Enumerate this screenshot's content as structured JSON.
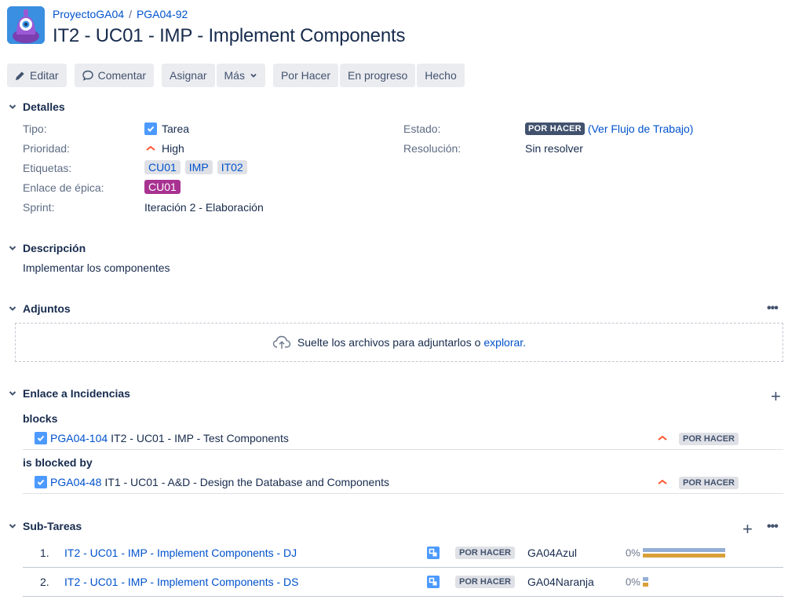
{
  "breadcrumbs": {
    "project": "ProyectoGA04",
    "separator": "/",
    "issue_key": "PGA04-92"
  },
  "title": "IT2 - UC01 - IMP - Implement Components",
  "toolbar": {
    "edit": "Editar",
    "comment": "Comentar",
    "assign": "Asignar",
    "more": "Más",
    "todo": "Por Hacer",
    "in_progress": "En progreso",
    "done": "Hecho"
  },
  "details": {
    "heading": "Detalles",
    "type_label": "Tipo:",
    "type_value": "Tarea",
    "priority_label": "Prioridad:",
    "priority_value": "High",
    "labels_label": "Etiquetas:",
    "labels": [
      "CU01",
      "IMP",
      "IT02"
    ],
    "epic_label": "Enlace de épica:",
    "epic_value": "CU01",
    "sprint_label": "Sprint:",
    "sprint_value": "Iteración 2 - Elaboración",
    "status_label": "Estado:",
    "status_value": "POR HACER",
    "workflow_link": "(Ver Flujo de Trabajo)",
    "resolution_label": "Resolución:",
    "resolution_value": "Sin resolver"
  },
  "description": {
    "heading": "Descripción",
    "text": "Implementar los componentes"
  },
  "attachments": {
    "heading": "Adjuntos",
    "more": "•••",
    "drop_text": "Suelte los archivos para adjuntarlos o",
    "browse": "explorar."
  },
  "links": {
    "heading": "Enlace a Incidencias",
    "add": "+",
    "groups": [
      {
        "type": "blocks",
        "key": "PGA04-104",
        "summary": "IT2 - UC01 - IMP - Test Components",
        "status": "POR HACER"
      },
      {
        "type": "is blocked by",
        "key": "PGA04-48",
        "summary": "IT1 - UC01 - A&D - Design the Database and Components",
        "status": "POR HACER"
      }
    ]
  },
  "subtasks": {
    "heading": "Sub-Tareas",
    "add": "+",
    "more": "•••",
    "rows": [
      {
        "num": "1.",
        "summary": "IT2 - UC01 - IMP - Implement Components - DJ",
        "status": "POR HACER",
        "assignee": "GA04Azul",
        "progress": "0%",
        "progress_value": 0
      },
      {
        "num": "2.",
        "summary": "IT2 - UC01 - IMP - Implement Components - DS",
        "status": "POR HACER",
        "assignee": "GA04Naranja",
        "progress": "0%",
        "progress_value": 0
      }
    ]
  },
  "colors": {
    "link": "#0052cc",
    "epic": "#a83291",
    "status_dark": "#42526e",
    "priority_high": "#ff5630",
    "progress_estimate": "#94aed6",
    "progress_remaining": "#d9a03a"
  }
}
